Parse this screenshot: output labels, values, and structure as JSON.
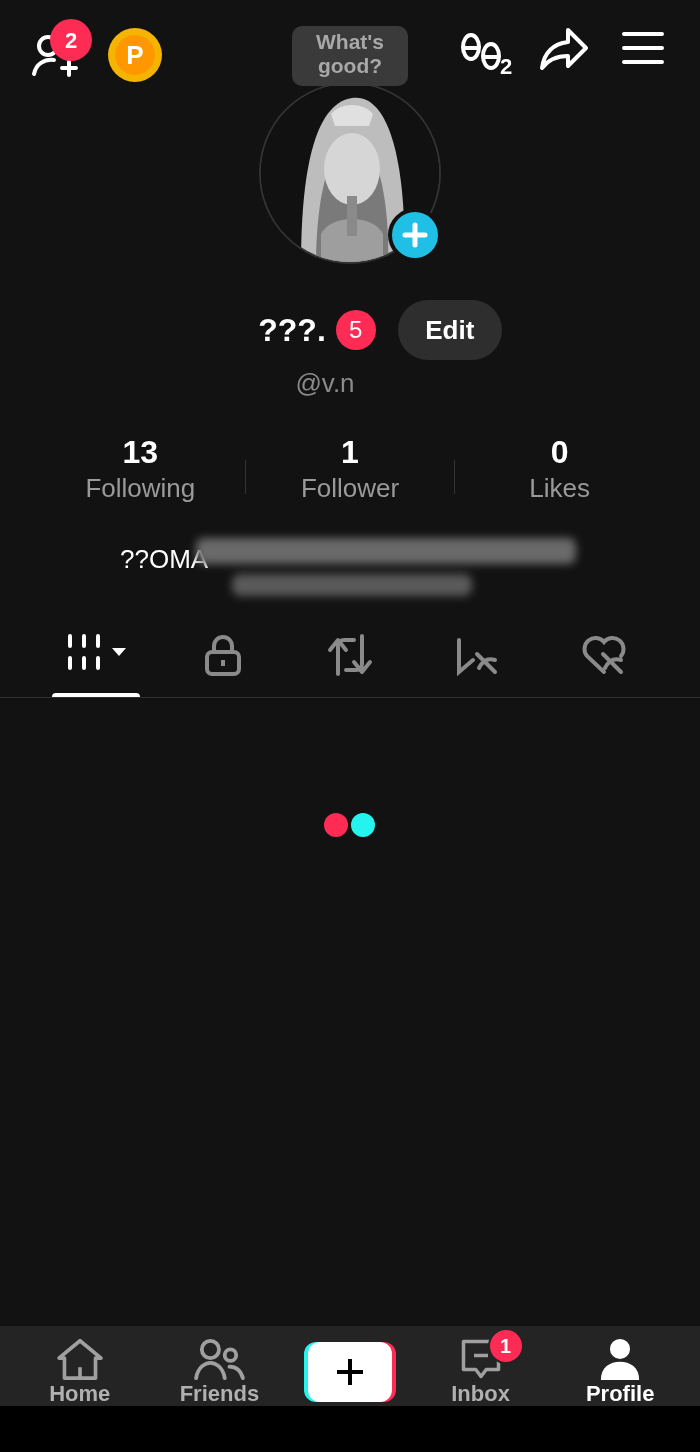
{
  "top_bar": {
    "friend_requests_badge": "2",
    "coin_label": "P",
    "status_bubble": "What's good?",
    "profile_views_count": "2"
  },
  "profile": {
    "name": "???.",
    "name_badge": "5",
    "edit_button": "Edit",
    "handle": "@v.n",
    "bio": "??OMA",
    "bio_redacted": true
  },
  "stats": [
    {
      "value": "13",
      "label": "Following"
    },
    {
      "value": "1",
      "label": "Follower"
    },
    {
      "value": "0",
      "label": "Likes"
    }
  ],
  "content_tabs": [
    {
      "kind": "videos",
      "selected": true
    },
    {
      "kind": "private",
      "selected": false
    },
    {
      "kind": "reposts",
      "selected": false
    },
    {
      "kind": "saved",
      "selected": false
    },
    {
      "kind": "liked",
      "selected": false
    }
  ],
  "loading": true,
  "nav": [
    {
      "kind": "home",
      "label": "Home",
      "selected": false
    },
    {
      "kind": "friends",
      "label": "Friends",
      "selected": false
    },
    {
      "kind": "create"
    },
    {
      "kind": "inbox",
      "label": "Inbox",
      "badge": "1",
      "selected": false
    },
    {
      "kind": "profile",
      "label": "Profile",
      "selected": true
    }
  ]
}
